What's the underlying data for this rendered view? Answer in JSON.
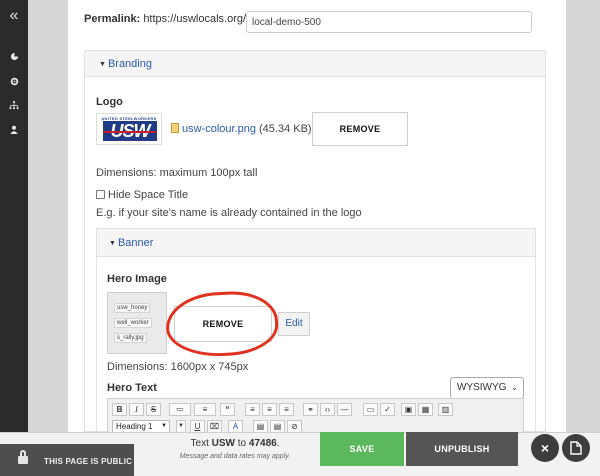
{
  "sidebar": {
    "icons": [
      "collapse-icon",
      "dashboard-icon",
      "settings-icon",
      "sitemap-icon",
      "user-icon"
    ]
  },
  "permalink": {
    "label": "Permalink:",
    "base_url": "https://uswlocals.org/",
    "value": "local-demo-500"
  },
  "branding": {
    "title": "Branding",
    "logo_label": "Logo",
    "logo_top_text": "UNITED STEELWORKERS",
    "logo_mark_text": "USW",
    "file_name": "usw-colour.png",
    "file_size": "(45.34 KB)",
    "remove_label": "REMOVE",
    "dimensions_text": "Dimensions: maximum 100px tall",
    "hide_title_label": "Hide Space Title",
    "hide_title_checked": false,
    "hint_text": "E.g. if your site's name is already contained in the logo"
  },
  "banner": {
    "title": "Banner",
    "hero_image_label": "Hero Image",
    "thumb_chips": [
      "usw_honey",
      "well_worker",
      "s_rally.jpg"
    ],
    "remove_label": "REMOVE",
    "edit_label": "Edit",
    "dimensions_text": "Dimensions: 1600px x 745px",
    "hero_text_label": "Hero Text",
    "editor_mode": "WYSIWYG",
    "format_select": "Heading 1"
  },
  "bottom_bar": {
    "public_label": "THIS PAGE IS PUBLIC",
    "text_prefix": "Text",
    "text_keyword": "USW",
    "text_to": "to",
    "text_number": "47486",
    "text_suffix": ".",
    "rates_note": "Message and data rates may apply.",
    "save_label": "SAVE",
    "unpublish_label": "UNPUBLISH",
    "close_symbol": "×",
    "page_symbol": "🗋"
  },
  "colors": {
    "link": "#2a5aa8",
    "save": "#5cb85c",
    "unpublish": "#555555",
    "annotation": "#e0321f",
    "sidebar": "#2b2b2b"
  }
}
